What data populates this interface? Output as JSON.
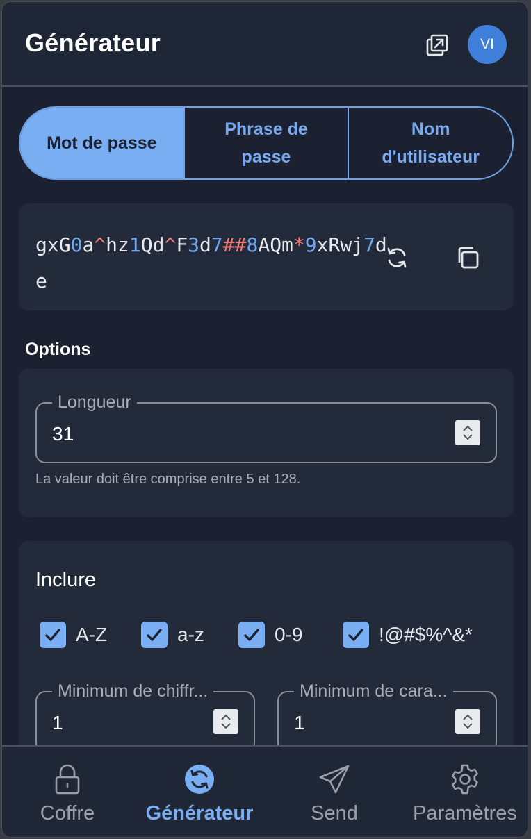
{
  "header": {
    "title": "Générateur",
    "avatar_initials": "VI"
  },
  "tabs": [
    {
      "label": "Mot de passe",
      "active": true
    },
    {
      "label": "Phrase de passe",
      "active": false
    },
    {
      "label": "Nom d'utilisateur",
      "active": false
    }
  ],
  "password": {
    "value": "gxG0a^hz1Qd^F3d7##8AQm*9xRwj7de",
    "colors": {
      "number": "#6fa6f2",
      "special": "#f07a7a"
    }
  },
  "options": {
    "title": "Options",
    "length": {
      "label": "Longueur",
      "value": "31",
      "hint": "La valeur doit être comprise entre 5 et 128."
    }
  },
  "include": {
    "title": "Inclure",
    "checkboxes": [
      {
        "label": "A-Z",
        "checked": true
      },
      {
        "label": "a-z",
        "checked": true
      },
      {
        "label": "0-9",
        "checked": true
      },
      {
        "label": "!@#$%^&*",
        "checked": true
      }
    ],
    "min_numbers": {
      "label": "Minimum de chiffr...",
      "value": "1"
    },
    "min_special": {
      "label": "Minimum de cara...",
      "value": "1"
    }
  },
  "nav": {
    "items": [
      {
        "label": "Coffre",
        "icon": "lock-icon",
        "active": false
      },
      {
        "label": "Générateur",
        "icon": "generator-icon",
        "active": true
      },
      {
        "label": "Send",
        "icon": "send-icon",
        "active": false
      },
      {
        "label": "Paramètres",
        "icon": "gear-icon",
        "active": false
      }
    ]
  },
  "theme": {
    "accent": "#7aaef2",
    "background": "#1b2130",
    "card": "#232b3a"
  }
}
